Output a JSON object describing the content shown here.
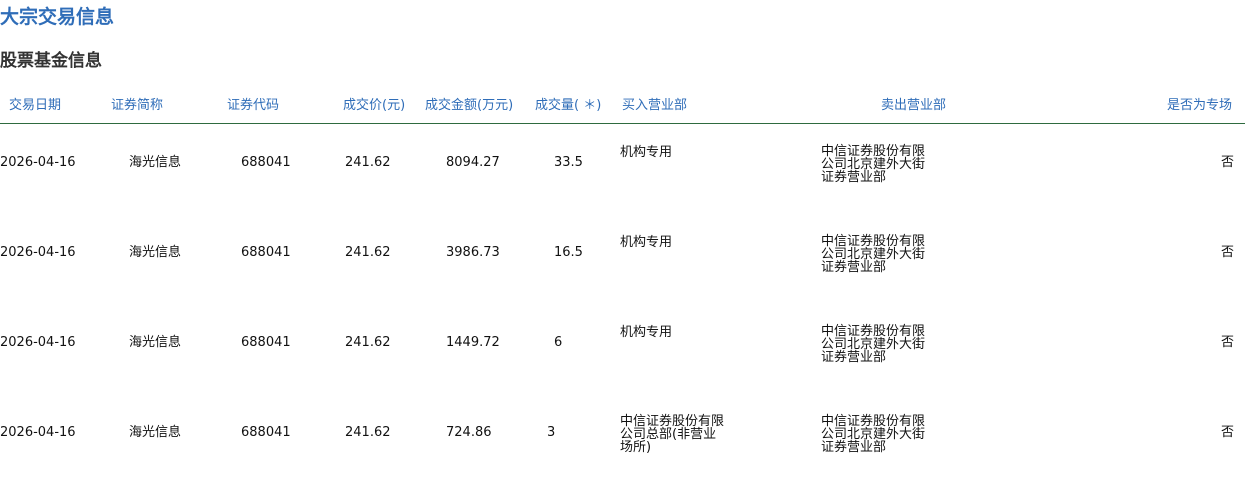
{
  "page_title": "大宗交易信息",
  "section_title": "股票基金信息",
  "table": {
    "columns": [
      "交易日期",
      "证券简称",
      "证券代码",
      "成交价(元)",
      "成交金额(万元)",
      "成交量( ＊)",
      "买入营业部",
      "卖出营业部",
      "是否为专场"
    ],
    "rows": [
      {
        "date": "2026-04-16",
        "name": "海光信息",
        "code": "688041",
        "price": "241.62",
        "amount": "8094.27",
        "volume": "33.5",
        "buyer": "机构专用",
        "seller": "中信证券股份有限公司北京建外大街证券营业部",
        "special": "否"
      },
      {
        "date": "2026-04-16",
        "name": "海光信息",
        "code": "688041",
        "price": "241.62",
        "amount": "3986.73",
        "volume": "16.5",
        "buyer": "机构专用",
        "seller": "中信证券股份有限公司北京建外大街证券营业部",
        "special": "否"
      },
      {
        "date": "2026-04-16",
        "name": "海光信息",
        "code": "688041",
        "price": "241.62",
        "amount": "1449.72",
        "volume": "6",
        "buyer": "机构专用",
        "seller": "中信证券股份有限公司北京建外大街证券营业部",
        "special": "否"
      },
      {
        "date": "2026-04-16",
        "name": "海光信息",
        "code": "688041",
        "price": "241.62",
        "amount": "724.86",
        "volume": "3",
        "buyer": "中信证券股份有限公司总部(非营业场所)",
        "seller": "中信证券股份有限公司北京建外大街证券营业部",
        "special": "否"
      }
    ]
  }
}
